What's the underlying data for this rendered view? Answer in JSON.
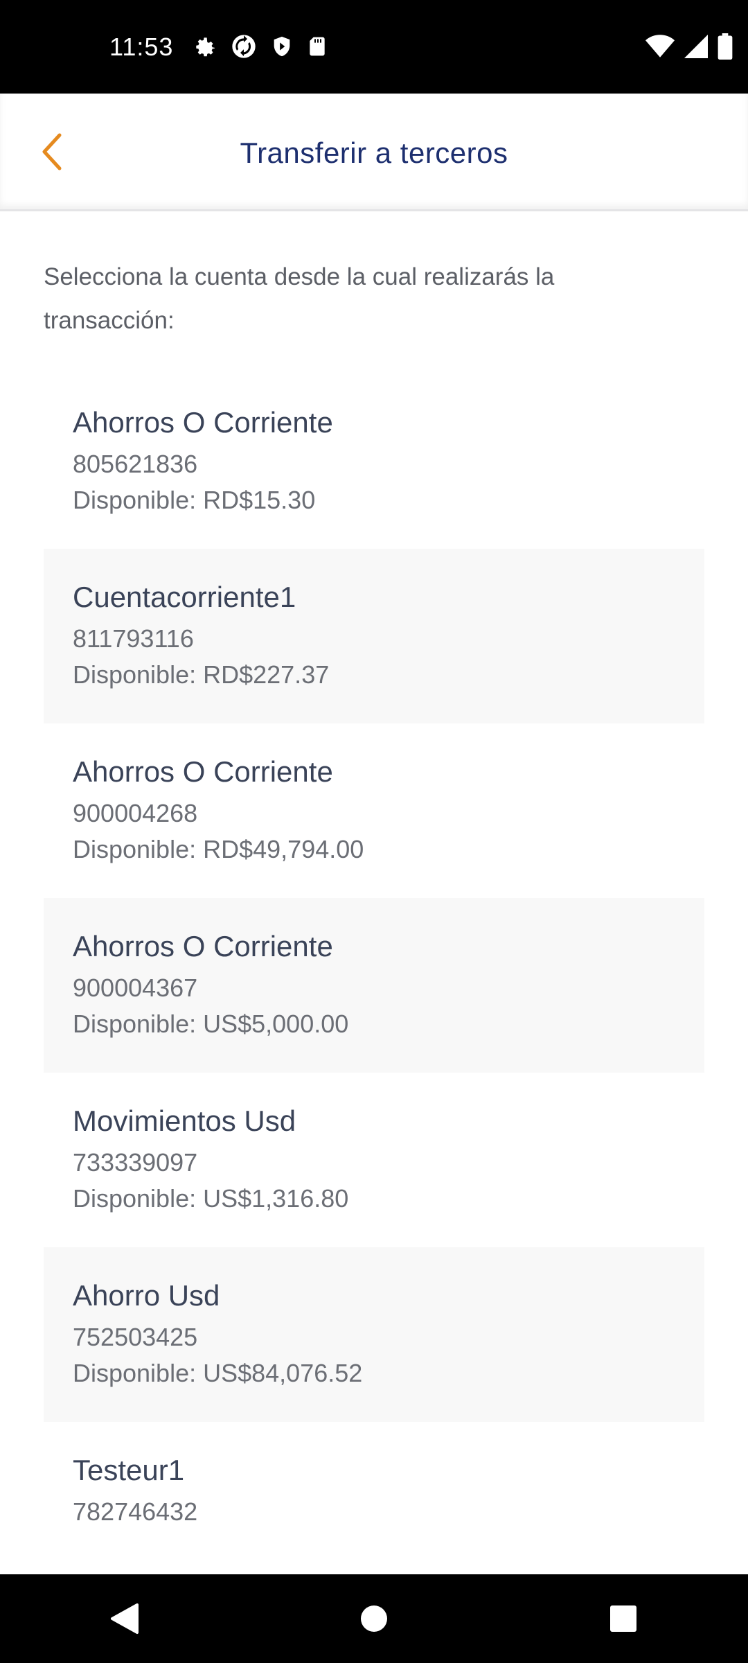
{
  "status_bar": {
    "time": "11:53",
    "left_icons": [
      "settings-icon",
      "sync-icon",
      "shield-icon",
      "sd-card-icon"
    ],
    "right_icons": [
      "wifi-icon",
      "signal-icon",
      "battery-icon"
    ]
  },
  "header": {
    "title": "Transferir a terceros",
    "back_icon": "chevron-left-icon",
    "accent_color": "#e58a1f",
    "title_color": "#1d2f6f"
  },
  "instruction": "Selecciona la cuenta desde la cual realizarás la transacción:",
  "accounts": [
    {
      "name": "Ahorros O Corriente",
      "number": "805621836",
      "balance": "Disponible: RD$15.30"
    },
    {
      "name": "Cuentacorriente1",
      "number": "811793116",
      "balance": "Disponible: RD$227.37"
    },
    {
      "name": "Ahorros O Corriente",
      "number": "900004268",
      "balance": "Disponible: RD$49,794.00"
    },
    {
      "name": "Ahorros O Corriente",
      "number": "900004367",
      "balance": "Disponible: US$5,000.00"
    },
    {
      "name": "Movimientos Usd",
      "number": "733339097",
      "balance": "Disponible: US$1,316.80"
    },
    {
      "name": "Ahorro Usd",
      "number": "752503425",
      "balance": "Disponible: US$84,076.52"
    },
    {
      "name": "Testeur1",
      "number": "782746432",
      "balance": ""
    }
  ],
  "nav_bar": {
    "icons": [
      "back-triangle-icon",
      "home-circle-icon",
      "recents-square-icon"
    ]
  }
}
